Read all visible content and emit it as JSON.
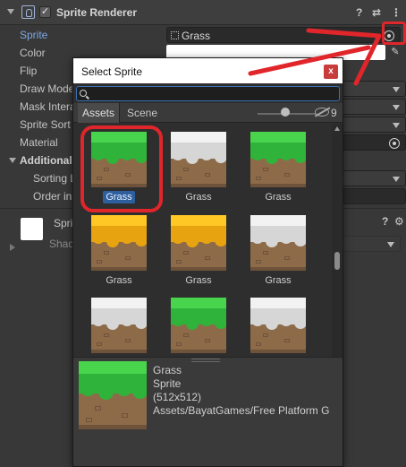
{
  "inspector": {
    "component_title": "Sprite Renderer",
    "enabled_check": "✓",
    "header_icons": [
      "?",
      "⇄",
      "⋮"
    ],
    "properties": [
      {
        "label": "Sprite",
        "value": "Grass"
      },
      {
        "label": "Color"
      },
      {
        "label": "Flip"
      },
      {
        "label": "Draw Mode"
      },
      {
        "label": "Mask Interaction"
      },
      {
        "label": "Sprite Sort Point"
      },
      {
        "label": "Material"
      },
      {
        "label": "Additional Settings"
      },
      {
        "label": "Sorting Layer"
      },
      {
        "label": "Order in Layer"
      }
    ],
    "shadow_component": {
      "title": "Sprite",
      "subtitle": "Shader"
    },
    "picker_glyph": "✎"
  },
  "picker": {
    "title": "Select Sprite",
    "close_label": "x",
    "search_value": "",
    "tabs": [
      "Assets",
      "Scene"
    ],
    "hidden_count": "9",
    "items": [
      {
        "name": "Grass",
        "style": "green",
        "selected": true
      },
      {
        "name": "Grass",
        "style": "snow",
        "selected": false
      },
      {
        "name": "Grass",
        "style": "green",
        "selected": false
      },
      {
        "name": "Grass",
        "style": "yellow",
        "selected": false
      },
      {
        "name": "Grass",
        "style": "yellow",
        "selected": false
      },
      {
        "name": "Grass",
        "style": "snow",
        "selected": false
      },
      {
        "name": "",
        "style": "snow",
        "selected": false
      },
      {
        "name": "",
        "style": "green",
        "selected": false
      },
      {
        "name": "",
        "style": "snow",
        "selected": false
      }
    ],
    "preview": {
      "name": "Grass",
      "type": "Sprite",
      "size": "(512x512)",
      "path": "Assets/BayatGames/Free Platform G"
    }
  },
  "colors": {
    "green_top": "#49d44e",
    "green_drip": "#2fb33a",
    "yellow_top": "#ffc825",
    "yellow_drip": "#e8a410",
    "snow_top": "#f2f2f2",
    "snow_drip": "#d6d6d6",
    "dirt": "#8d6b49",
    "highlight": "#e0262b"
  }
}
